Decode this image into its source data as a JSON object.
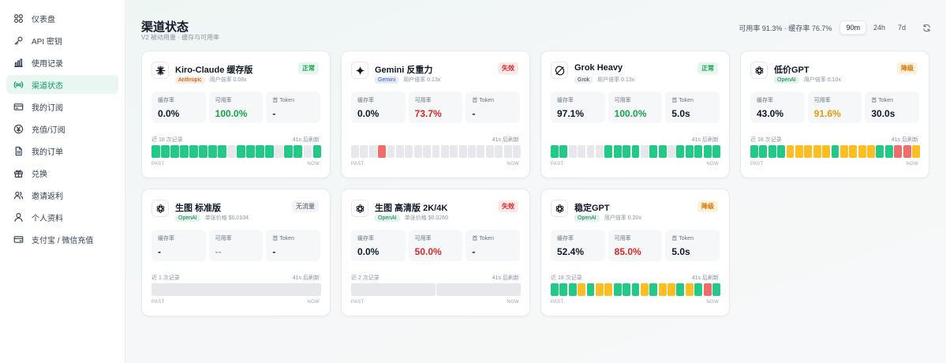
{
  "sidebar": {
    "items": [
      {
        "label": "仪表盘",
        "icon": "dashboard-icon",
        "active": false
      },
      {
        "label": "API 密钥",
        "icon": "key-icon",
        "active": false
      },
      {
        "label": "使用记录",
        "icon": "bar-chart-icon",
        "active": false
      },
      {
        "label": "渠道状态",
        "icon": "signal-icon",
        "active": true
      },
      {
        "label": "我的订阅",
        "icon": "card-icon",
        "active": false
      },
      {
        "label": "充值/订阅",
        "icon": "yen-icon",
        "active": false
      },
      {
        "label": "我的订单",
        "icon": "document-icon",
        "active": false
      },
      {
        "label": "兑换",
        "icon": "gift-icon",
        "active": false
      },
      {
        "label": "邀请返利",
        "icon": "users-icon",
        "active": false
      },
      {
        "label": "个人资料",
        "icon": "user-icon",
        "active": false
      },
      {
        "label": "支付宝 / 微信充值",
        "icon": "wallet-icon",
        "active": false
      }
    ]
  },
  "header": {
    "title": "渠道状态",
    "subtitle": "V2 被动用量 · 缓存与可用率",
    "summary": "可用率 91.3% · 缓存率 76.7%",
    "ranges": [
      {
        "label": "90m",
        "active": true
      },
      {
        "label": "24h",
        "active": false
      },
      {
        "label": "7d",
        "active": false
      }
    ],
    "refresh_icon": "refresh-icon"
  },
  "labels": {
    "cache": "缓存率",
    "availability": "可用率",
    "first_token": "首 Token",
    "past": "PAST",
    "now": "NOW"
  },
  "colors": {
    "green": "#22c987",
    "red": "#f26b6b",
    "amber": "#fbbf24",
    "empty": "#e6e8eb",
    "accent": "#109a6b"
  },
  "cards": [
    {
      "name": "Kiro-Claude 缓存版",
      "logo": "anthropic-icon",
      "provider": "Anthropic",
      "provider_class": "prov-anthropic",
      "rate": "用户倍率 0.08x",
      "status": "正常",
      "status_class": "st-ok",
      "cache": "0.0%",
      "cache_class": "",
      "availability": "100.0%",
      "availability_class": "v-green",
      "first_token": "-",
      "first_token_class": "",
      "history": "近 18 次记录",
      "refresh": "41s 后刷新",
      "bars": [
        "g",
        "g",
        "g",
        "g",
        "g",
        "g",
        "g",
        "g",
        "e",
        "g",
        "g",
        "g",
        "g",
        "e",
        "g",
        "g",
        "e",
        "g"
      ]
    },
    {
      "name": "Gemini 反重力",
      "logo": "gemini-icon",
      "provider": "Gemini",
      "provider_class": "prov-gemini",
      "rate": "用户倍率 0.13x",
      "status": "失效",
      "status_class": "st-fail",
      "cache": "0.0%",
      "cache_class": "",
      "availability": "73.7%",
      "availability_class": "v-red",
      "first_token": "-",
      "first_token_class": "",
      "history": "",
      "refresh": "41s 后刷新",
      "bars": [
        "e",
        "e",
        "e",
        "r",
        "e",
        "e",
        "e",
        "e",
        "e",
        "e",
        "e",
        "e",
        "e",
        "e",
        "e",
        "e",
        "e",
        "e",
        "e"
      ]
    },
    {
      "name": "Grok Heavy",
      "logo": "grok-icon",
      "provider": "Grok",
      "provider_class": "prov-grok",
      "rate": "用户倍率 0.13x",
      "status": "正常",
      "status_class": "st-ok",
      "cache": "97.1%",
      "cache_class": "",
      "availability": "100.0%",
      "availability_class": "v-green",
      "first_token": "5.0s",
      "first_token_class": "",
      "history": "",
      "refresh": "41s 后刷新",
      "bars": [
        "g",
        "g",
        "e",
        "e",
        "e",
        "e",
        "g",
        "g",
        "g",
        "g",
        "e",
        "g",
        "g",
        "e",
        "g",
        "g",
        "g",
        "g",
        "g"
      ]
    },
    {
      "name": "低价GPT",
      "logo": "openai-icon",
      "provider": "OpenAI",
      "provider_class": "prov-openai",
      "rate": "用户倍率 0.10x",
      "status": "降级",
      "status_class": "st-warn",
      "cache": "43.0%",
      "cache_class": "",
      "availability": "91.6%",
      "availability_class": "v-amber",
      "first_token": "30.0s",
      "first_token_class": "",
      "history": "近 18 次记录",
      "refresh": "41s 后刷新",
      "bars": [
        "g",
        "g",
        "g",
        "g",
        "y",
        "y",
        "y",
        "y",
        "y",
        "g",
        "y",
        "y",
        "y",
        "y",
        "g",
        "g",
        "r",
        "r",
        "y"
      ]
    },
    {
      "name": "生图 标准版",
      "logo": "openai-icon",
      "provider": "OpenAI",
      "provider_class": "prov-openai",
      "rate": "单张价格 $0.0104",
      "status": "无流量",
      "status_class": "st-none",
      "cache": "-",
      "cache_class": "",
      "availability": "--",
      "availability_class": "v-dim",
      "first_token": "-",
      "first_token_class": "",
      "history": "近 1 次记录",
      "refresh": "41s 后刷新",
      "bars": [
        "e"
      ]
    },
    {
      "name": "生图 高清版 2K/4K",
      "logo": "openai-icon",
      "provider": "OpenAI",
      "provider_class": "prov-openai",
      "rate": "单张价格 $0.0260",
      "status": "失效",
      "status_class": "st-fail",
      "cache": "0.0%",
      "cache_class": "",
      "availability": "50.0%",
      "availability_class": "v-red",
      "first_token": "-",
      "first_token_class": "",
      "history": "近 2 次记录",
      "refresh": "41s 后刷新",
      "bars": [
        "e",
        "e"
      ]
    },
    {
      "name": "稳定GPT",
      "logo": "openai-icon",
      "provider": "OpenAI",
      "provider_class": "prov-openai",
      "rate": "用户倍率 0.20x",
      "status": "降级",
      "status_class": "st-warn",
      "cache": "52.4%",
      "cache_class": "",
      "availability": "85.0%",
      "availability_class": "v-red",
      "first_token": "5.0s",
      "first_token_class": "",
      "history": "近 18 次记录",
      "refresh": "41s 后刷新",
      "bars": [
        "g",
        "g",
        "g",
        "y",
        "g",
        "y",
        "y",
        "g",
        "g",
        "g",
        "y",
        "g",
        "y",
        "y",
        "g",
        "y",
        "g",
        "r",
        "g"
      ]
    }
  ]
}
